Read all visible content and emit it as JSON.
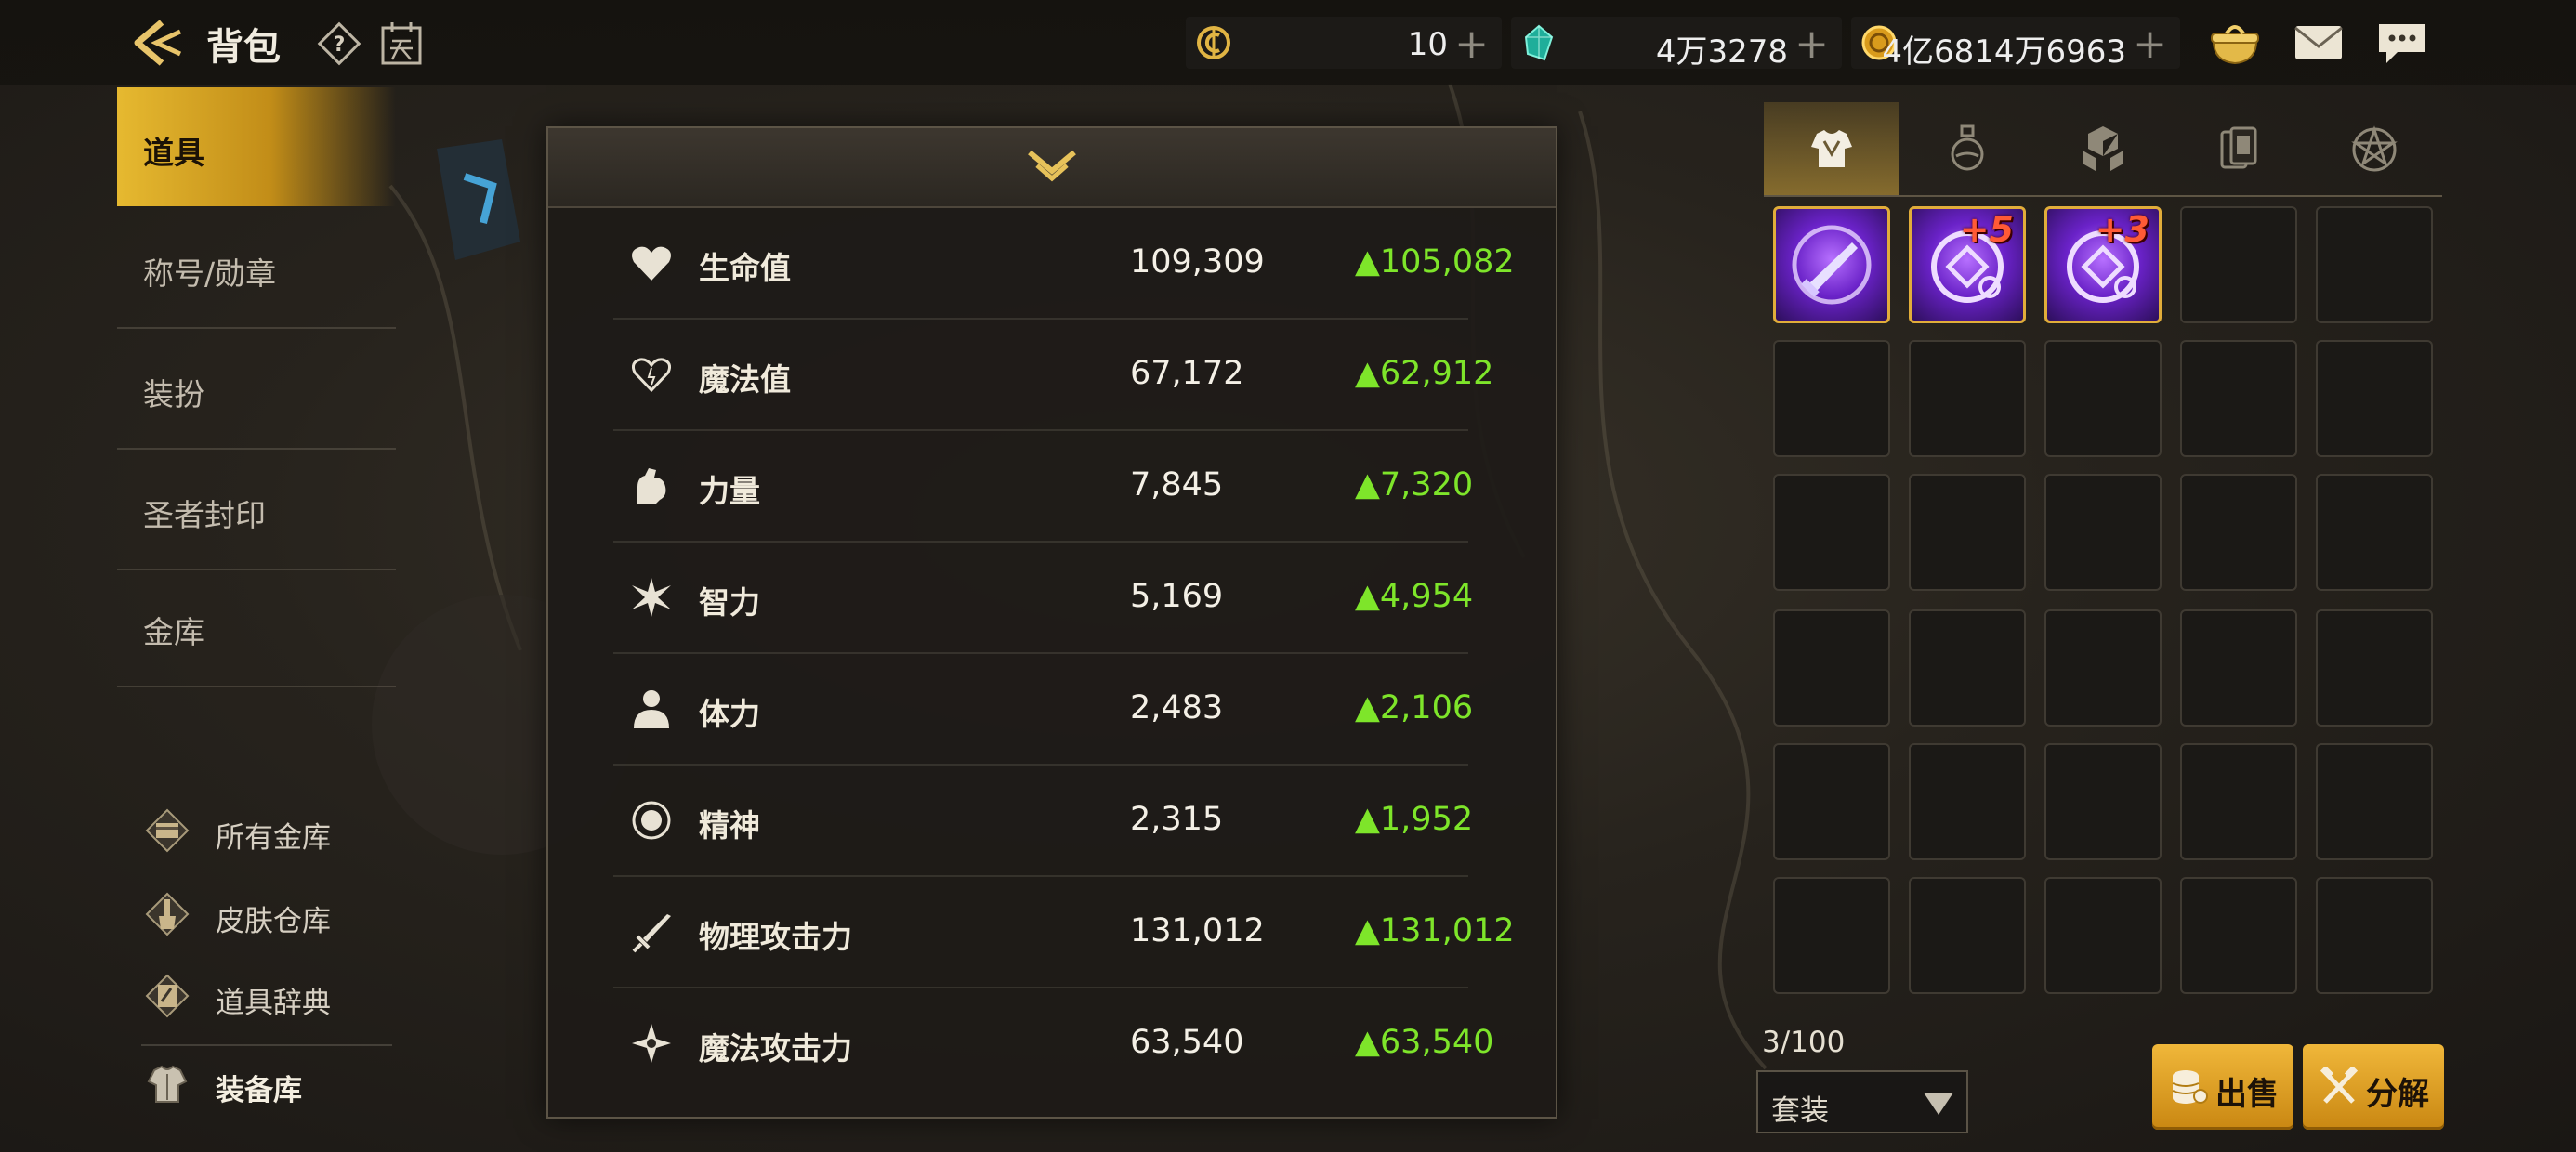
{
  "header": {
    "title": "背包",
    "currencies": [
      {
        "icon": "coupon-coin-icon",
        "value": "10"
      },
      {
        "icon": "crystal-icon",
        "value": "4万3278"
      },
      {
        "icon": "gold-coin-icon",
        "value": "4亿6814万6963"
      }
    ]
  },
  "nav": {
    "items": [
      {
        "label": "道具"
      },
      {
        "label": "称号/勋章"
      },
      {
        "label": "装扮"
      },
      {
        "label": "圣者封印"
      },
      {
        "label": "金库"
      }
    ],
    "sub": [
      {
        "label": "所有金库"
      },
      {
        "label": "皮肤仓库"
      },
      {
        "label": "道具辞典"
      },
      {
        "label": "装备库"
      }
    ]
  },
  "stats": [
    {
      "name": "生命值",
      "value": "109,309",
      "delta": "▲105,082",
      "icon": "heart-icon"
    },
    {
      "name": "魔法值",
      "value": "67,172",
      "delta": "▲62,912",
      "icon": "heart-outline-icon"
    },
    {
      "name": "力量",
      "value": "7,845",
      "delta": "▲7,320",
      "icon": "arm-strength-icon"
    },
    {
      "name": "智力",
      "value": "5,169",
      "delta": "▲4,954",
      "icon": "burst-icon"
    },
    {
      "name": "体力",
      "value": "2,483",
      "delta": "▲2,106",
      "icon": "body-icon"
    },
    {
      "name": "精神",
      "value": "2,315",
      "delta": "▲1,952",
      "icon": "spirit-circle-icon"
    },
    {
      "name": "物理攻击力",
      "value": "131,012",
      "delta": "▲131,012",
      "icon": "sword-icon"
    },
    {
      "name": "魔法攻击力",
      "value": "63,540",
      "delta": "▲63,540",
      "icon": "magic-star-icon"
    }
  ],
  "inventory": {
    "tabs": [
      "armor-tab-icon",
      "potion-tab-icon",
      "material-tab-icon",
      "card-tab-icon",
      "pentagram-tab-icon"
    ],
    "items": [
      {
        "enhance": ""
      },
      {
        "enhance": "+5"
      },
      {
        "enhance": "+3"
      }
    ],
    "count": "3/100",
    "filter": "套装"
  },
  "buttons": {
    "sell": "出售",
    "disassemble": "分解"
  },
  "colors": {
    "accent_gold": "#e6b930",
    "delta_green": "#7ee52a",
    "item_purple": "#7a2fe0",
    "enhance_red": "#ff5a36"
  }
}
